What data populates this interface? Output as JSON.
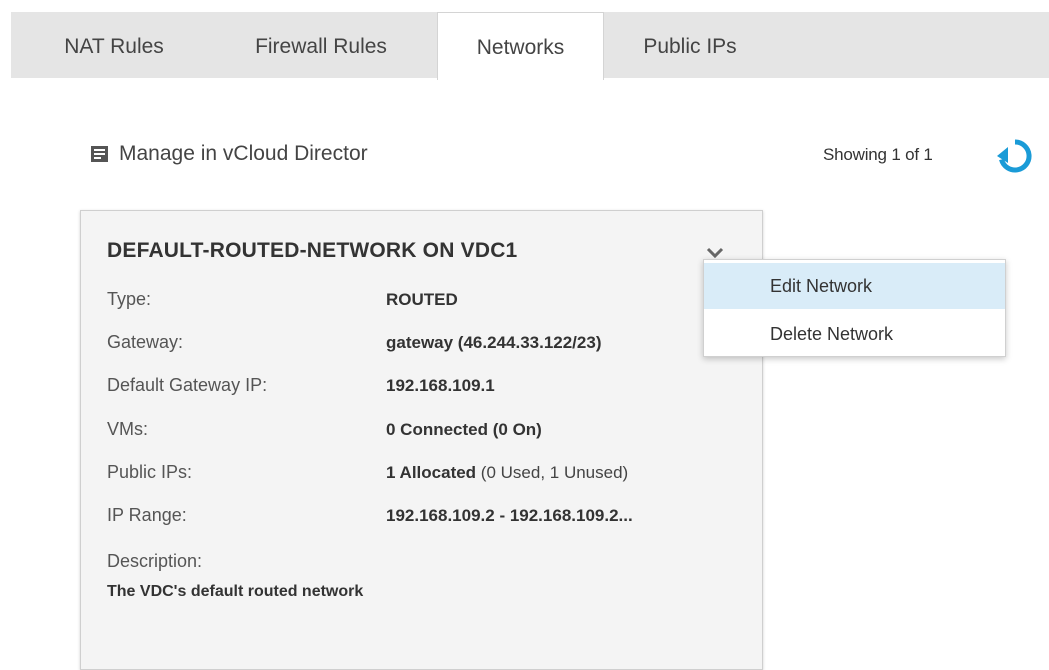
{
  "tabs": [
    {
      "label": "NAT Rules",
      "active": false
    },
    {
      "label": "Firewall Rules",
      "active": false
    },
    {
      "label": "Networks",
      "active": true
    },
    {
      "label": "Public IPs",
      "active": false
    }
  ],
  "toolbar": {
    "manage_label": "Manage in vCloud Director",
    "manage_icon": "list-document-icon",
    "showing_text": "Showing 1 of 1",
    "refresh_icon": "refresh-icon"
  },
  "network_card": {
    "title": "DEFAULT-ROUTED-NETWORK ON VDC1",
    "rows": [
      {
        "label": "Type:",
        "value": "ROUTED"
      },
      {
        "label": "Gateway:",
        "value": "gateway (46.244.33.122/23)"
      },
      {
        "label": "Default Gateway IP:",
        "value": "192.168.109.1"
      },
      {
        "label": "VMs:",
        "value": "0 Connected (0 On)"
      },
      {
        "label": "Public IPs:",
        "value": "1 Allocated",
        "value_extra": " (0 Used, 1 Unused)"
      },
      {
        "label": "IP Range:",
        "value": "192.168.109.2 - 192.168.109.2..."
      }
    ],
    "description_label": "Description:",
    "description_value": "The VDC's default routed network"
  },
  "dropdown_menu": {
    "items": [
      {
        "label": "Edit Network",
        "highlighted": true
      },
      {
        "label": "Delete Network",
        "highlighted": false
      }
    ]
  },
  "colors": {
    "accent": "#1a9bd7",
    "tabbar_bg": "#e5e5e5",
    "card_bg": "#f4f4f4",
    "menu_highlight": "#d9ecf8"
  }
}
